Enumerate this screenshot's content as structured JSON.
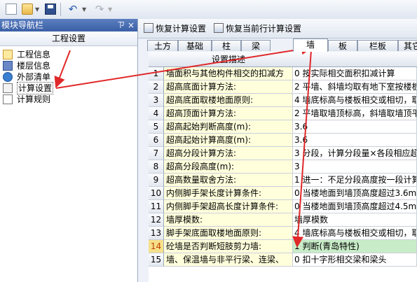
{
  "panel": {
    "header": "模块导航栏",
    "pin": "ㄗ",
    "close": "×",
    "title": "工程设置",
    "items": [
      {
        "label": "工程信息",
        "icon": "info-icon"
      },
      {
        "label": "楼层信息",
        "icon": "floor-icon"
      },
      {
        "label": "外部清单",
        "icon": "external-list-icon"
      },
      {
        "label": "计算设置",
        "icon": "calc-settings-icon"
      },
      {
        "label": "计算规则",
        "icon": "calc-rules-icon"
      }
    ]
  },
  "right_toolbar": {
    "restore_calc": "恢复计算设置",
    "restore_current_row": "恢复当前行计算设置"
  },
  "tabs": [
    "土方",
    "基础",
    "柱",
    "梁",
    "墙",
    "板",
    "栏板",
    "其它"
  ],
  "active_tab": "墙",
  "grid": {
    "header_desc": "设置描述",
    "selected_row": 14,
    "rows": [
      {
        "num": "1",
        "desc": "墙面积与其他构件相交的扣减方",
        "val": "0 按实际相交面积扣减计算"
      },
      {
        "num": "2",
        "desc": "超高底面计算方法:",
        "val": "2 平墙、斜墙均取有地下室按楼板"
      },
      {
        "num": "3",
        "desc": "超高底面取楼地面原则:",
        "val": "4 墙底标高与楼板相交或相切，取"
      },
      {
        "num": "4",
        "desc": "超高顶面计算方法:",
        "val": "2 平墙取墙顶标高，斜墙取墙顶平"
      },
      {
        "num": "5",
        "desc": "超高起始判断高度(m):",
        "val": "3.6"
      },
      {
        "num": "6",
        "desc": "超高起始计算高度(m):",
        "val": "3.6"
      },
      {
        "num": "7",
        "desc": "超高分段计算方法:",
        "val": "3 分段，计算分段量×各段相应超"
      },
      {
        "num": "8",
        "desc": "超高分段高度(m):",
        "val": "3"
      },
      {
        "num": "9",
        "desc": "超高数量取舍方法:",
        "val": "1 进一：不足分段高度按一段计算"
      },
      {
        "num": "10",
        "desc": "内侧脚手架长度计算条件:",
        "val": "0 当楼地面到墙顶高度超过3.6m时"
      },
      {
        "num": "11",
        "desc": "内侧脚手架超高长度计算条件:",
        "val": "0 当楼地面到墙顶高度超过4.5m时"
      },
      {
        "num": "12",
        "desc": "墙厚模数:",
        "val": "墙厚模数"
      },
      {
        "num": "13",
        "desc": "脚手架底面取楼地面原则:",
        "val": "4 墙底标高与楼板相交或相切，取"
      },
      {
        "num": "14",
        "desc": "砼墙是否判断短肢剪力墙:",
        "val": "1 判断(青岛特性)"
      },
      {
        "num": "15",
        "desc": "墙、保温墙与非平行梁、连梁、",
        "val": "0 扣十字形相交梁和梁头"
      }
    ]
  }
}
